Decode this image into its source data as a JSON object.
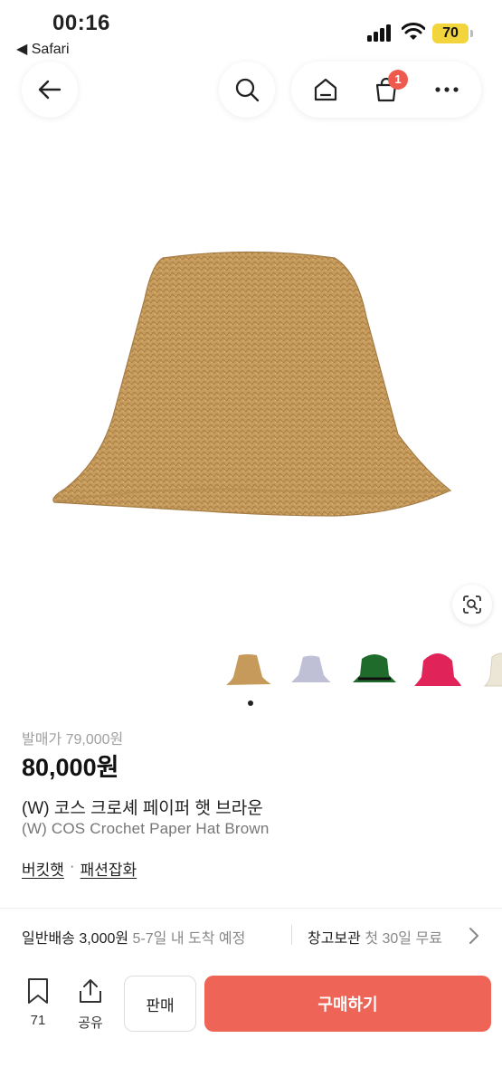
{
  "status_bar": {
    "time": "00:16",
    "back_app": "◀ Safari",
    "battery": "70"
  },
  "nav": {
    "cart_badge": "1"
  },
  "product": {
    "release_price": "발매가 79,000원",
    "price": "80,000원",
    "name_ko": "(W) 코스 크로셰 페이퍼 햇 브라운",
    "name_en": "(W) COS Crochet Paper Hat Brown",
    "category_1": "버킷햇",
    "category_sep": "·",
    "category_2": "패션잡화"
  },
  "thumbnails": [
    {
      "color": "#c59a5b",
      "name": "brown"
    },
    {
      "color": "#bfc0d6",
      "name": "lilac"
    },
    {
      "color": "#1e6b2c",
      "name": "green"
    },
    {
      "color": "#e0245a",
      "name": "pink"
    },
    {
      "color": "#ece6d6",
      "name": "cream"
    }
  ],
  "shipping": {
    "general_label": "일반배송 3,000원",
    "general_eta": "5-7일 내 도착 예정",
    "storage_label": "창고보관",
    "storage_note": "첫 30일 무료"
  },
  "bottom_bar": {
    "wish_count": "71",
    "share_label": "공유",
    "sell_label": "판매",
    "buy_label": "구매하기"
  },
  "colors": {
    "accent": "#ee6457",
    "badge": "#ee5a4d",
    "hat": "#c8a063"
  },
  "icons": [
    "arrow-left-icon",
    "search-icon",
    "home-icon",
    "shopping-bag-icon",
    "more-icon",
    "lens-icon",
    "bookmark-icon",
    "share-icon",
    "chevron-right-icon"
  ]
}
